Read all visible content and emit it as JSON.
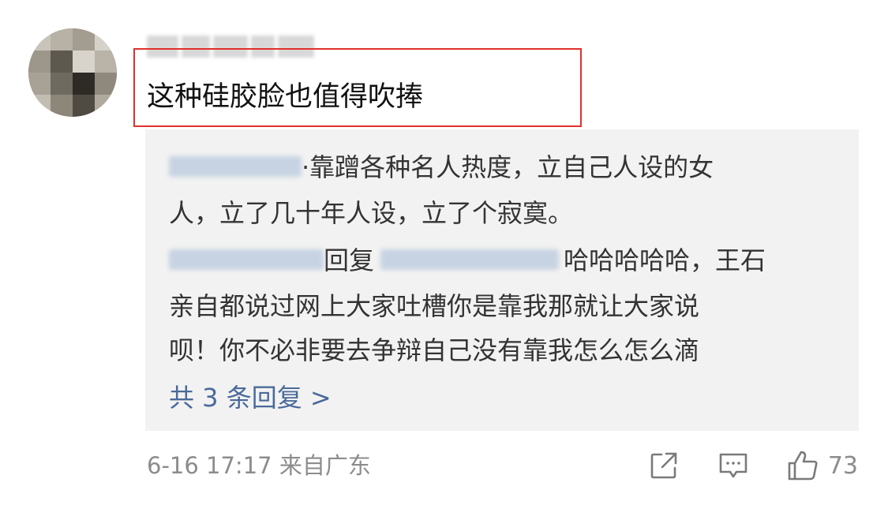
{
  "comment": {
    "text": "这种硅胶脸也值得吹捧"
  },
  "replies": {
    "first": {
      "separator": "·",
      "text_line1": "靠蹭各种名人热度，立自己人设的女",
      "text_line2": "人，立了几十年人设，立了个寂寞。"
    },
    "second": {
      "reply_word": "回复",
      "text_line1": "哈哈哈哈哈，王石",
      "text_line2": "亲自都说过网上大家吐槽你是靠我那就让大家说",
      "text_line3": "呗！你不必非要去争辩自己没有靠我怎么怎么滴"
    },
    "more_label": "共 3 条回复 >"
  },
  "footer": {
    "meta": "6-16 17:17  来自广东",
    "like_count": "73"
  },
  "icons": {
    "share": "share-icon",
    "comment": "comment-icon",
    "like": "thumbs-up-icon"
  },
  "colors": {
    "highlight_border": "#e0302c",
    "link_blue": "#4a6a9a",
    "reply_bg": "#f2f2f2"
  }
}
